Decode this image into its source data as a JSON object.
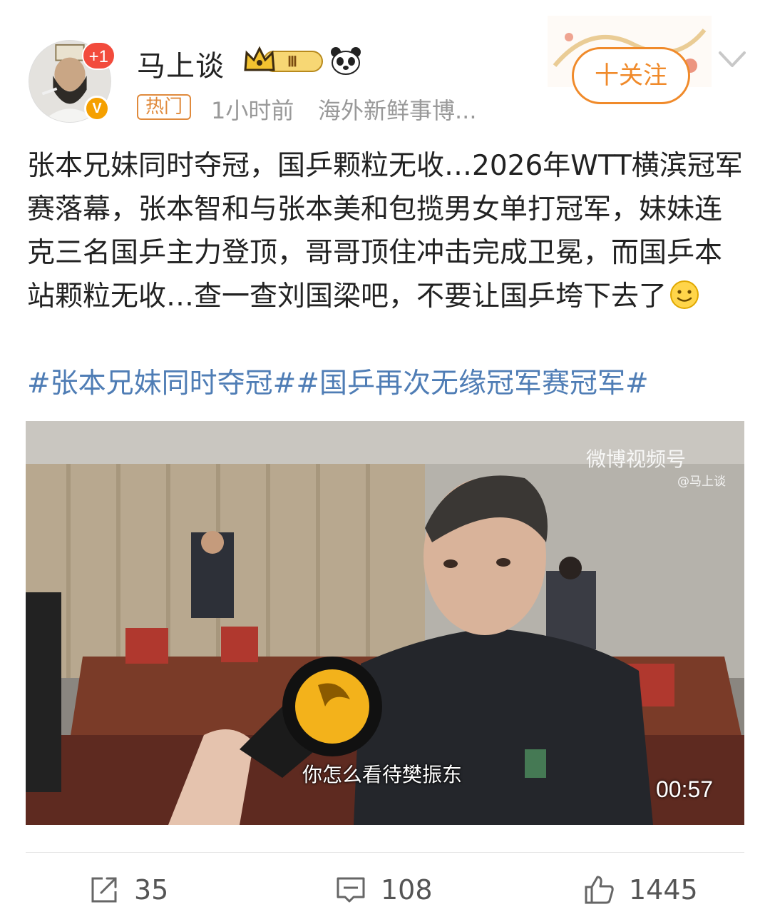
{
  "user": {
    "name": "马上谈",
    "avatar_badge": "+1",
    "verified_mark": "V",
    "level_badge": "Ⅲ",
    "level_badge_icon": "crown-icon",
    "emoji_badge_icon": "panda-icon"
  },
  "meta": {
    "hot_tag": "热门",
    "time": "1小时前",
    "source": "海外新鲜事博..."
  },
  "follow": {
    "label": "十关注"
  },
  "post": {
    "text": "张本兄妹同时夺冠，国乒颗粒无收…2026年WTT横滨冠军赛落幕，张本智和与张本美和包揽男女单打冠军，妹妹连克三名国乒主力登顶，哥哥顶住冲击完成卫冕，而国乒本站颗粒无收…查一查刘国梁吧，不要让国乒垮下去了",
    "emoji_icon": "smile-icon",
    "hashtags": "#张本兄妹同时夺冠##国乒再次无缘冠军赛冠军#"
  },
  "video": {
    "watermark": "微博视频号",
    "watermark_user": "@马上谈",
    "subtitle": "你怎么看待樊振东",
    "duration": "00:57"
  },
  "actions": {
    "share_count": "35",
    "comment_count": "108",
    "like_count": "1445"
  },
  "colors": {
    "accent_orange": "#f08a2a",
    "link_blue": "#4f7db5",
    "meta_gray": "#999999",
    "badge_red": "#f24b3c",
    "verified_gold": "#f5a000"
  }
}
